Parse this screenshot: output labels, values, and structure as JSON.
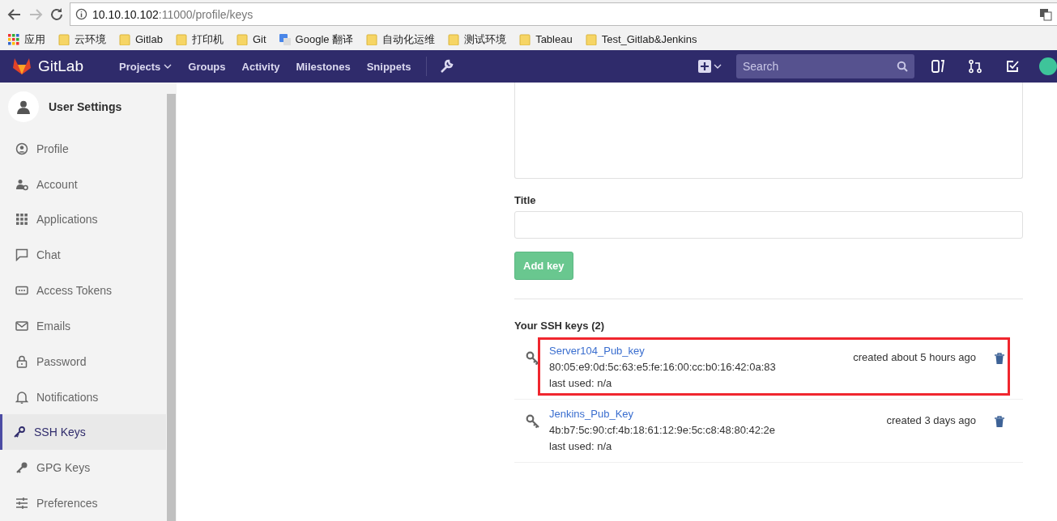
{
  "browser": {
    "url_host": "10.10.10.102",
    "url_path": ":11000/profile/keys",
    "bookmarks": [
      {
        "label": "应用",
        "kind": "apps"
      },
      {
        "label": "云环境",
        "kind": "folder"
      },
      {
        "label": "Gitlab",
        "kind": "folder"
      },
      {
        "label": "打印机",
        "kind": "folder"
      },
      {
        "label": "Git",
        "kind": "folder"
      },
      {
        "label": "Google 翻译",
        "kind": "translate"
      },
      {
        "label": "自动化运维",
        "kind": "folder"
      },
      {
        "label": "测试环境",
        "kind": "folder"
      },
      {
        "label": "Tableau",
        "kind": "folder"
      },
      {
        "label": "Test_Gitlab&Jenkins",
        "kind": "folder"
      }
    ]
  },
  "navbar": {
    "brand": "GitLab",
    "links": [
      {
        "label": "Projects",
        "dropdown": true
      },
      {
        "label": "Groups",
        "dropdown": false
      },
      {
        "label": "Activity",
        "dropdown": false
      },
      {
        "label": "Milestones",
        "dropdown": false
      },
      {
        "label": "Snippets",
        "dropdown": false
      }
    ],
    "search": {
      "placeholder": "Search"
    }
  },
  "sidebar": {
    "title": "User Settings",
    "items": [
      {
        "label": "Profile",
        "selected": false
      },
      {
        "label": "Account",
        "selected": false
      },
      {
        "label": "Applications",
        "selected": false
      },
      {
        "label": "Chat",
        "selected": false
      },
      {
        "label": "Access Tokens",
        "selected": false
      },
      {
        "label": "Emails",
        "selected": false
      },
      {
        "label": "Password",
        "selected": false
      },
      {
        "label": "Notifications",
        "selected": false
      },
      {
        "label": "SSH Keys",
        "selected": true
      },
      {
        "label": "GPG Keys",
        "selected": false
      },
      {
        "label": "Preferences",
        "selected": false
      }
    ]
  },
  "form": {
    "title_label": "Title",
    "submit": "Add key"
  },
  "keys_heading": "Your SSH keys (2)",
  "keys": [
    {
      "title": "Server104_Pub_key",
      "fingerprint": "80:05:e9:0d:5c:63:e5:fe:16:00:cc:b0:16:42:0a:83",
      "last_used": "last used: n/a",
      "created": "created about 5 hours ago",
      "highlighted": true
    },
    {
      "title": "Jenkins_Pub_Key",
      "fingerprint": "4b:b7:5c:90:cf:4b:18:61:12:9e:5c:c8:48:80:42:2e",
      "last_used": "last used: n/a",
      "created": "created 3 days ago",
      "highlighted": false
    }
  ]
}
